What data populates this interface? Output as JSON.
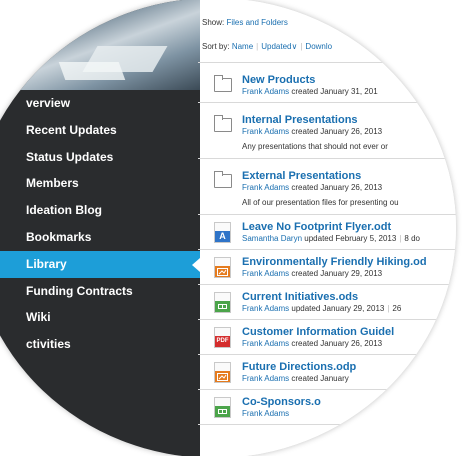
{
  "sidebar": {
    "banner_alt": "mountain-banner",
    "items": [
      {
        "label": "verview",
        "active": false
      },
      {
        "label": "Recent Updates",
        "active": false
      },
      {
        "label": "Status Updates",
        "active": false
      },
      {
        "label": "Members",
        "active": false
      },
      {
        "label": "Ideation Blog",
        "active": false
      },
      {
        "label": "Bookmarks",
        "active": false
      },
      {
        "label": "Library",
        "active": true
      },
      {
        "label": "Funding Contracts",
        "active": false
      },
      {
        "label": "Wiki",
        "active": false
      },
      {
        "label": "ctivities",
        "active": false
      }
    ]
  },
  "filter": {
    "show_label": "Show:",
    "show_value": "Files and Folders"
  },
  "sort": {
    "label": "Sort by:",
    "options": [
      "Name",
      "Updated∨",
      "Downlo"
    ]
  },
  "files": [
    {
      "type": "folder",
      "title": "New Products",
      "who": "Frank Adams",
      "action": "created January 31, 201",
      "extra": "",
      "desc": ""
    },
    {
      "type": "folder",
      "title": "Internal Presentations",
      "who": "Frank Adams",
      "action": "created January 26, 2013",
      "extra": "",
      "desc": "Any presentations that should not ever or"
    },
    {
      "type": "folder",
      "title": "External Presentations",
      "who": "Frank Adams",
      "action": "created January 26, 2013",
      "extra": "",
      "desc": "All of our presentation files for presenting ou"
    },
    {
      "type": "odt",
      "title": "Leave No Footprint Flyer.odt",
      "who": "Samantha Daryn",
      "action": "updated February 5, 2013",
      "extra": "8 do",
      "desc": ""
    },
    {
      "type": "odp",
      "title": "Environmentally Friendly Hiking.od",
      "who": "Frank Adams",
      "action": "created January 29, 2013",
      "extra": "",
      "desc": ""
    },
    {
      "type": "ods",
      "title": "Current Initiatives.ods",
      "who": "Frank Adams",
      "action": "updated January 29, 2013",
      "extra": "26",
      "desc": ""
    },
    {
      "type": "pdf",
      "title": "Customer Information Guidel",
      "who": "Frank Adams",
      "action": "created January 26, 2013",
      "extra": "",
      "desc": ""
    },
    {
      "type": "odp",
      "title": "Future Directions.odp",
      "who": "Frank Adams",
      "action": "created January",
      "extra": "",
      "desc": ""
    },
    {
      "type": "ods",
      "title": "Co-Sponsors.o",
      "who": "Frank Adams",
      "action": "",
      "extra": "",
      "desc": ""
    }
  ],
  "icons": {
    "odt_glyph": "A",
    "pdf_glyph": "PDF"
  },
  "colors": {
    "accent": "#1d9ed8",
    "sidebar": "#2a2c2e",
    "link": "#1a6fb0"
  }
}
